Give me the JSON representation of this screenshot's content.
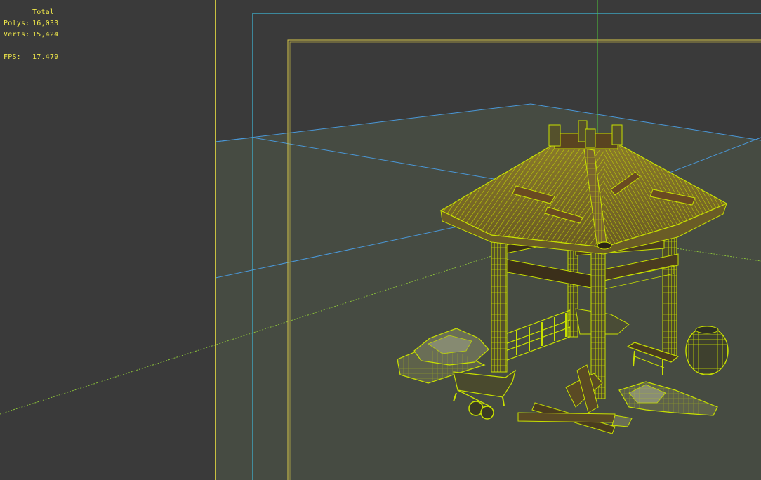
{
  "viewport": {
    "stats": {
      "header": "Total",
      "polys_label": "Polys:",
      "polys_value": "16,033",
      "verts_label": "Verts:",
      "verts_value": "15,424",
      "fps_label": "FPS:",
      "fps_value": "17.479"
    },
    "colors": {
      "background": "#3a3a3a",
      "ground": "#464b42",
      "safe_frame_outer": "#3fb8d8",
      "safe_frame_inner": "#d8c84a",
      "gate_edge": "#c8c040",
      "wireframe": "#c8e000",
      "hud_text": "#f0e84a",
      "grid_blue": "#4a98d8",
      "grid_green": "#8abf3a",
      "pivot_axis": "#4ec83a"
    },
    "scene_objects": [
      "thatched-pavilion",
      "stone-pile-left",
      "wheelbarrow",
      "timber-pile",
      "stone-pile-right",
      "bench",
      "woven-basket"
    ]
  }
}
